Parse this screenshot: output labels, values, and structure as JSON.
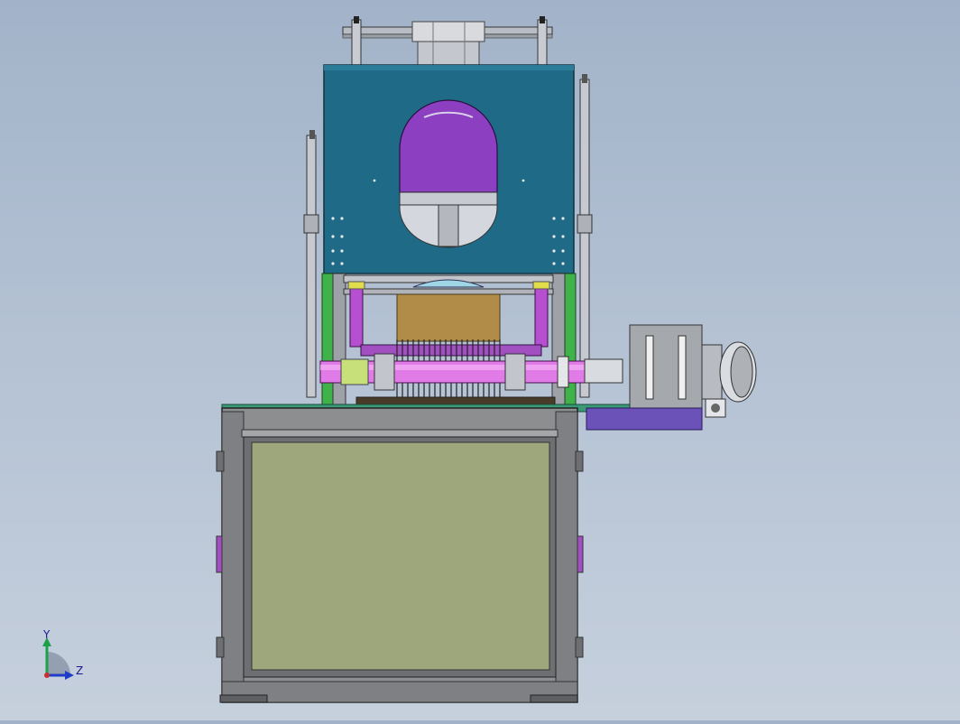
{
  "viewport": {
    "background_top": "#a2b3c9",
    "background_bottom": "#c6d0dd"
  },
  "colors": {
    "housing": "#1f6a86",
    "window": "#8c3fc0",
    "panel": "#9ea77c",
    "frame": "#8c8e90",
    "plate": "#3a9a78",
    "slot_bracket": "#c9a44a",
    "motor_base": "#6a52b8",
    "rod": "#c9c9cf"
  },
  "triad": {
    "y_label": "Y",
    "z_label": "Z"
  }
}
